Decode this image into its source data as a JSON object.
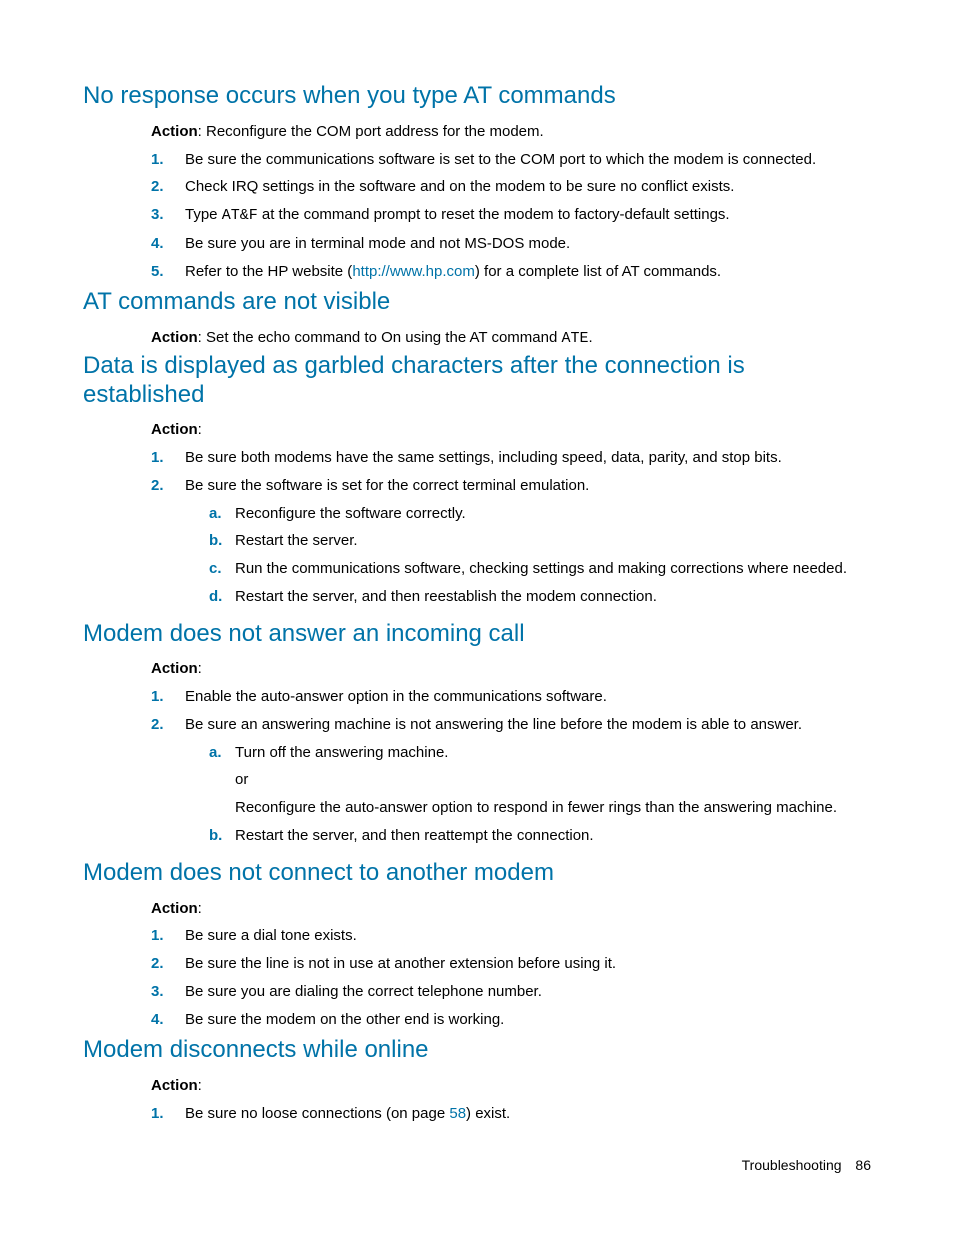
{
  "sections": [
    {
      "title": "No response occurs when you type AT commands",
      "action_label": "Action",
      "action_text": ": Reconfigure the COM port address for the modem.",
      "items": [
        {
          "m": "1.",
          "text": "Be sure the communications software is set to the COM port to which the modem is connected."
        },
        {
          "m": "2.",
          "text": "Check IRQ settings in the software and on the modem to be sure no conflict exists."
        },
        {
          "m": "3.",
          "pre": "Type ",
          "code": "AT&F",
          "post": " at the command prompt to reset the modem to factory-default settings."
        },
        {
          "m": "4.",
          "text": "Be sure you are in terminal mode and not MS-DOS mode."
        },
        {
          "m": "5.",
          "pre": "Refer to the HP website (",
          "link_text": "http://www.hp.com",
          "post": ") for a complete list of AT commands."
        }
      ]
    },
    {
      "title": "AT commands are not visible",
      "action_label": "Action",
      "action_pre": ": Set the echo command to On using the AT command ",
      "action_code": "ATE",
      "action_post": "."
    },
    {
      "title": "Data is displayed as garbled characters after the connection is established",
      "action_label": "Action",
      "action_text": ":",
      "items": [
        {
          "m": "1.",
          "text": "Be sure both modems have the same settings, including speed, data, parity, and stop bits."
        },
        {
          "m": "2.",
          "text": "Be sure the software is set for the correct terminal emulation.",
          "sub": [
            {
              "m": "a.",
              "text": "Reconfigure the software correctly."
            },
            {
              "m": "b.",
              "text": "Restart the server."
            },
            {
              "m": "c.",
              "text": "Run the communications software, checking settings and making corrections where needed."
            },
            {
              "m": "d.",
              "text": "Restart the server, and then reestablish the modem connection."
            }
          ]
        }
      ]
    },
    {
      "title": "Modem does not answer an incoming call",
      "action_label": "Action",
      "action_text": ":",
      "items": [
        {
          "m": "1.",
          "text": "Enable the auto-answer option in the communications software."
        },
        {
          "m": "2.",
          "text": "Be sure an answering machine is not answering the line before the modem is able to answer.",
          "sub": [
            {
              "m": "a.",
              "text": "Turn off the answering machine.",
              "or": "or",
              "after": "Reconfigure the auto-answer option to respond in fewer rings than the answering machine."
            },
            {
              "m": "b.",
              "text": "Restart the server, and then reattempt the connection."
            }
          ]
        }
      ]
    },
    {
      "title": "Modem does not connect to another modem",
      "action_label": "Action",
      "action_text": ":",
      "items": [
        {
          "m": "1.",
          "text": "Be sure a dial tone exists."
        },
        {
          "m": "2.",
          "text": "Be sure the line is not in use at another extension before using it."
        },
        {
          "m": "3.",
          "text": "Be sure you are dialing the correct telephone number."
        },
        {
          "m": "4.",
          "text": "Be sure the modem on the other end is working."
        }
      ]
    },
    {
      "title": "Modem disconnects while online",
      "action_label": "Action",
      "action_text": ":",
      "items": [
        {
          "m": "1.",
          "pre": "Be sure no loose connections (on page ",
          "link_text": "58",
          "post": ") exist."
        }
      ]
    }
  ],
  "footer_label": "Troubleshooting",
  "footer_page": "86"
}
